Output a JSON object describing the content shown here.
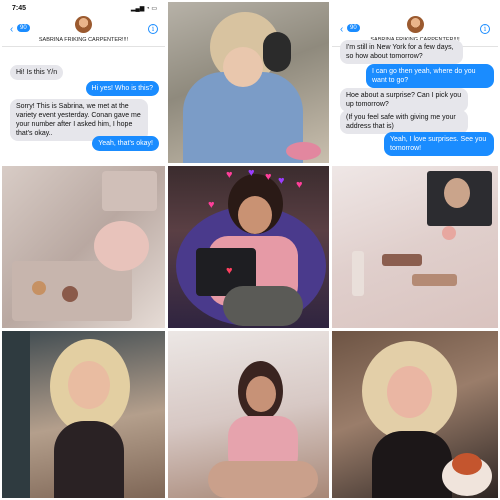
{
  "chat1": {
    "time": "7:45",
    "back_count": "90",
    "contact_name": "SABRINA FRIKING CARPENTER!!!!",
    "messages": [
      {
        "side": "in",
        "text": "Hi! Is this Y/n"
      },
      {
        "side": "out",
        "text": "Hi yes! Who is this?"
      },
      {
        "side": "in",
        "text": "Sorry! This is Sabrina, we met at the variety event yesterday. Conan gave me your number after I asked him, I hope that's okay.."
      },
      {
        "side": "out",
        "text": "Yeah, that's okay!"
      }
    ]
  },
  "chat2": {
    "back_count": "90",
    "contact_name": "SABRINA FRIKING CARPENTER!!!!",
    "messages": [
      {
        "side": "in",
        "text": "I'm still in New York for a few days, so how about tomorrow?"
      },
      {
        "side": "out",
        "text": "I can go then yeah, where do you want to go?"
      },
      {
        "side": "in",
        "text": "Hoe about a surprise? Can I pick you up tomorrow?"
      },
      {
        "side": "in",
        "text": "(If you feel safe with giving me your address that is)"
      },
      {
        "side": "out",
        "text": "Yeah, I love surprises. See you tomorrow!"
      }
    ]
  },
  "status_icons": "▂▄▆ ◔ ▭",
  "icons": {
    "back": "chevron-left-icon",
    "info": "info-icon",
    "heart": "heart-icon"
  },
  "heart_glyph": "♥",
  "colors": {
    "bubble_out": "#1a8cff",
    "bubble_in": "#e6e6eb",
    "accent_pink": "#ff3e9a",
    "accent_purple": "#9b3dff"
  }
}
